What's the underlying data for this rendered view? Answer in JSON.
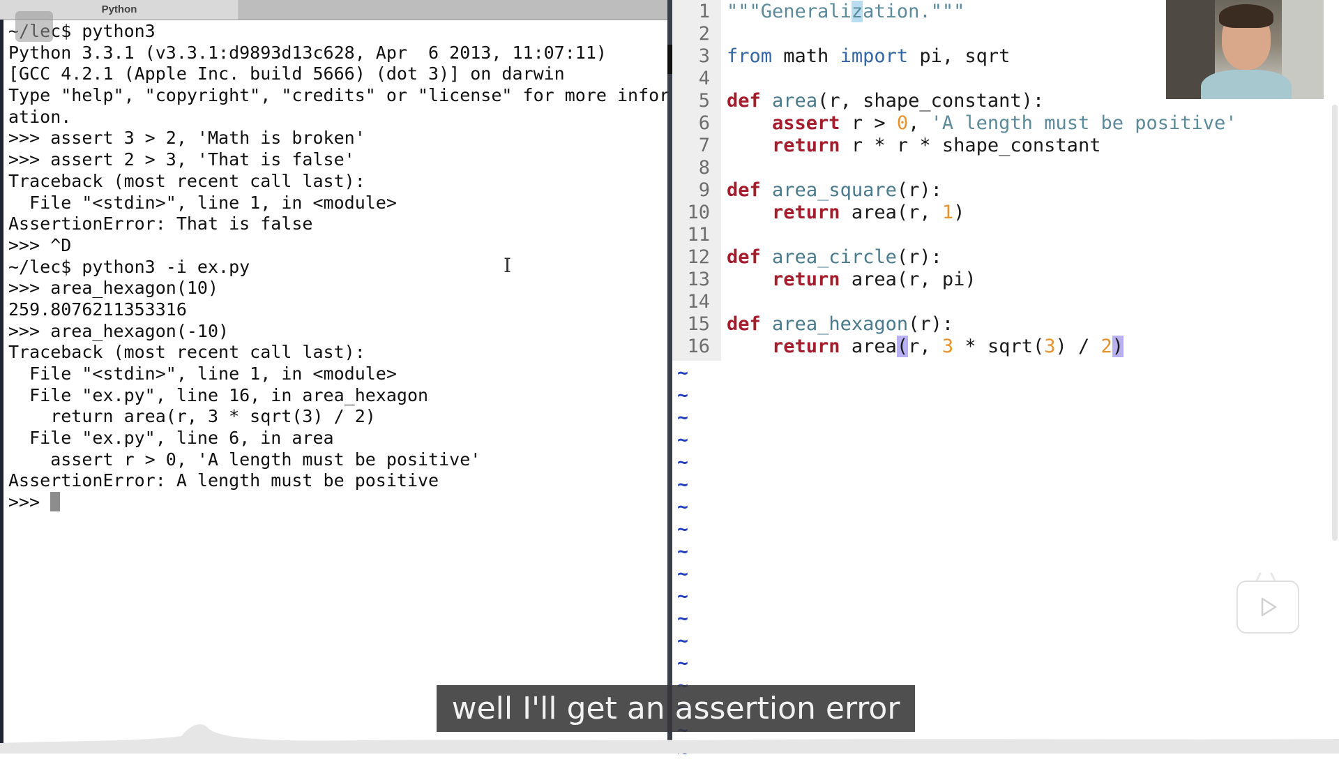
{
  "terminal": {
    "tab_label": "Python",
    "corner_icon_text": "",
    "lines": [
      "~/lec$ python3",
      "Python 3.3.1 (v3.3.1:d9893d13c628, Apr  6 2013, 11:07:11)",
      "[GCC 4.2.1 (Apple Inc. build 5666) (dot 3)] on darwin",
      "Type \"help\", \"copyright\", \"credits\" or \"license\" for more inform",
      "ation.",
      ">>> assert 3 > 2, 'Math is broken'",
      ">>> assert 2 > 3, 'That is false'",
      "Traceback (most recent call last):",
      "  File \"<stdin>\", line 1, in <module>",
      "AssertionError: That is false",
      ">>> ^D",
      "~/lec$ python3 -i ex.py",
      ">>> area_hexagon(10)",
      "259.8076211353316",
      ">>> area_hexagon(-10)",
      "Traceback (most recent call last):",
      "  File \"<stdin>\", line 1, in <module>",
      "  File \"ex.py\", line 16, in area_hexagon",
      "    return area(r, 3 * sqrt(3) / 2)",
      "  File \"ex.py\", line 6, in area",
      "    assert r > 0, 'A length must be positive'",
      "AssertionError: A length must be positive"
    ],
    "prompt": ">>> "
  },
  "editor": {
    "line_numbers": [
      "1",
      "2",
      "3",
      "4",
      "5",
      "6",
      "7",
      "8",
      "9",
      "10",
      "11",
      "12",
      "13",
      "14",
      "15",
      "16"
    ],
    "tilde": "~",
    "tilde_count": 18,
    "code": {
      "l1a": "\"\"\"Generali",
      "l1b": "z",
      "l1c": "ation.\"\"\"",
      "from": "from",
      "math": " math ",
      "import": "import",
      "imports": " pi, sqrt",
      "def": "def",
      "area": "area",
      "area_sig": "(r, shape_constant):",
      "assert": "assert",
      "assert_mid": " r > ",
      "zero": "0",
      "comma": ", ",
      "assert_msg": "'A length must be positive'",
      "return": "return",
      "ret7": " r * r * shape_constant",
      "area_square": "area_square",
      "sig_r": "(r):",
      "ret10a": " area(r, ",
      "one": "1",
      "close": ")",
      "area_circle": "area_circle",
      "ret13": " area(r, pi)",
      "area_hexagon": "area_hexagon",
      "ret16a": " area",
      "paren_open": "(",
      "ret16b": "r, ",
      "three": "3",
      "ret16c": " * sqrt(",
      "three2": "3",
      "ret16d": ") / ",
      "two": "2",
      "paren_close": ")"
    }
  },
  "subtitle": "well I'll get an assertion error",
  "colors": {
    "keyword": "#a51d2d",
    "import_keyword": "#3465a4",
    "function_name": "#4a7a8c",
    "string": "#5b8a9a",
    "number": "#e8922c",
    "tilde": "#1f3fbf"
  }
}
